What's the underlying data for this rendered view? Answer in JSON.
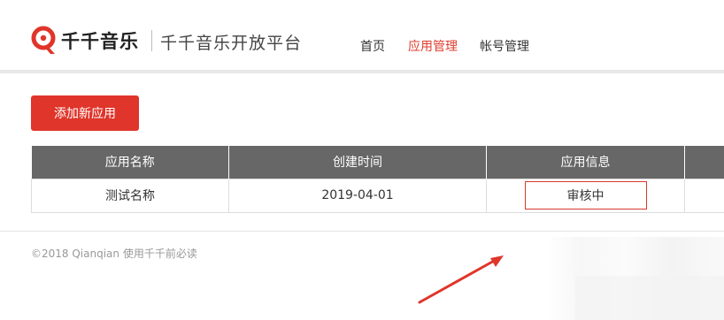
{
  "header": {
    "logo_text": "千千音乐",
    "platform_title": "千千音乐开放平台",
    "nav": [
      {
        "label": "首页",
        "active": false
      },
      {
        "label": "应用管理",
        "active": true
      },
      {
        "label": "帐号管理",
        "active": false
      }
    ]
  },
  "main": {
    "add_button_label": "添加新应用",
    "table": {
      "columns": [
        "应用名称",
        "创建时间",
        "应用信息",
        ""
      ],
      "rows": [
        {
          "name": "测试名称",
          "created": "2019-04-01",
          "status": "审核中",
          "extra": ""
        }
      ]
    }
  },
  "footer": {
    "copyright": "©2018 Qianqian",
    "link": "使用千千前必读"
  },
  "colors": {
    "accent": "#e0352a",
    "header_bg": "#676767"
  },
  "icons": {
    "logo": "qianqian-logo-icon",
    "annotation": "red-arrow-icon"
  }
}
